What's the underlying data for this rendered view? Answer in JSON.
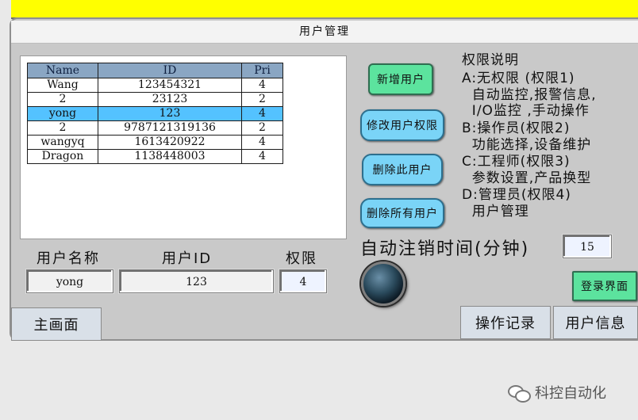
{
  "window": {
    "title": "用户管理"
  },
  "table": {
    "columns": [
      "Name",
      "ID",
      "Pri"
    ],
    "rows": [
      {
        "name": "Wang",
        "id": "123454321",
        "pri": "4",
        "selected": false
      },
      {
        "name": "2",
        "id": "23123",
        "pri": "2",
        "selected": false
      },
      {
        "name": "yong",
        "id": "123",
        "pri": "4",
        "selected": true
      },
      {
        "name": "2",
        "id": "9787121319136",
        "pri": "2",
        "selected": false
      },
      {
        "name": "wangyq",
        "id": "1613420922",
        "pri": "4",
        "selected": false
      },
      {
        "name": "Dragon",
        "id": "1138448003",
        "pri": "4",
        "selected": false
      }
    ]
  },
  "buttons": {
    "add_user": "新增用户",
    "modify_permission": "修改用户权限",
    "delete_user": "删除此用户",
    "delete_all_users": "删除所有用户",
    "login_screen": "登录界面"
  },
  "permissions": {
    "heading": "权限说明",
    "lines": [
      "A:无权限 (权限1)",
      "  自动监控,报警信息,",
      "  I/O监控 ,手动操作",
      "B:操作员(权限2)",
      "  功能选择,设备维护",
      "C:工程师(权限3)",
      "  参数设置,产品换型",
      "D:管理员(权限4)",
      "  用户管理"
    ]
  },
  "form": {
    "username_label": "用户名称",
    "userid_label": "用户ID",
    "permission_label": "权限",
    "username_value": "yong",
    "userid_value": "123",
    "permission_value": "4"
  },
  "logout": {
    "label": "自动注销时间(分钟)",
    "value": "15"
  },
  "tabs": {
    "main": "主画面",
    "operation_log": "操作记录",
    "user_info": "用户信息"
  },
  "watermark": {
    "text": "科控自动化"
  },
  "colors": {
    "top_bar": "#ffff00",
    "header_row": "#8aa6c3",
    "selected_row": "#54c2ff",
    "green_button": "#5ce39e",
    "cyan_button": "#7ad4f7"
  }
}
